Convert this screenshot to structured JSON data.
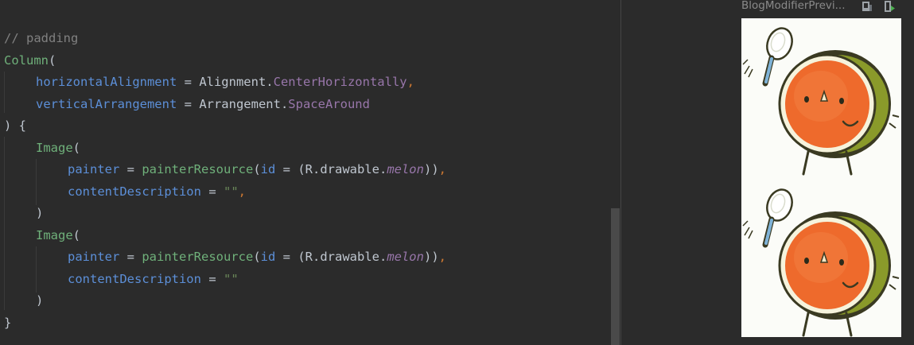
{
  "editor": {
    "lines": [
      {
        "segments": [
          {
            "t": "// padding",
            "c": "comment"
          }
        ]
      },
      {
        "segments": [
          {
            "t": "Column",
            "c": "call"
          },
          {
            "t": "(",
            "c": "plain"
          }
        ]
      },
      {
        "segments": [
          {
            "t": "horizontalAlignment",
            "c": "param"
          },
          {
            "t": " = ",
            "c": "plain"
          },
          {
            "t": "Alignment.",
            "c": "plain"
          },
          {
            "t": "CenterHorizontally",
            "c": "prop"
          },
          {
            "t": ",",
            "c": "punc"
          }
        ]
      },
      {
        "segments": [
          {
            "t": "verticalArrangement",
            "c": "param"
          },
          {
            "t": " = ",
            "c": "plain"
          },
          {
            "t": "Arrangement.",
            "c": "plain"
          },
          {
            "t": "SpaceAround",
            "c": "prop"
          }
        ]
      },
      {
        "segments": [
          {
            "t": ") {",
            "c": "plain"
          }
        ]
      },
      {
        "segments": [
          {
            "t": "Image",
            "c": "call"
          },
          {
            "t": "(",
            "c": "plain"
          }
        ]
      },
      {
        "segments": [
          {
            "t": "painter",
            "c": "param"
          },
          {
            "t": " = ",
            "c": "plain"
          },
          {
            "t": "painterResource",
            "c": "call"
          },
          {
            "t": "(",
            "c": "plain"
          },
          {
            "t": "id",
            "c": "param"
          },
          {
            "t": " = ",
            "c": "plain"
          },
          {
            "t": "(R.drawable.",
            "c": "plain"
          },
          {
            "t": "melon",
            "c": "ital"
          },
          {
            "t": "))",
            "c": "plain"
          },
          {
            "t": ",",
            "c": "punc"
          }
        ]
      },
      {
        "segments": [
          {
            "t": "contentDescription",
            "c": "param"
          },
          {
            "t": " = ",
            "c": "plain"
          },
          {
            "t": "\"\"",
            "c": "str"
          },
          {
            "t": ",",
            "c": "punc"
          }
        ]
      },
      {
        "segments": [
          {
            "t": ")",
            "c": "plain"
          }
        ]
      },
      {
        "segments": [
          {
            "t": "Image",
            "c": "call"
          },
          {
            "t": "(",
            "c": "plain"
          }
        ]
      },
      {
        "segments": [
          {
            "t": "painter",
            "c": "param"
          },
          {
            "t": " = ",
            "c": "plain"
          },
          {
            "t": "painterResource",
            "c": "call"
          },
          {
            "t": "(",
            "c": "plain"
          },
          {
            "t": "id",
            "c": "param"
          },
          {
            "t": " = ",
            "c": "plain"
          },
          {
            "t": "(R.drawable.",
            "c": "plain"
          },
          {
            "t": "melon",
            "c": "ital"
          },
          {
            "t": "))",
            "c": "plain"
          },
          {
            "t": ",",
            "c": "punc"
          }
        ]
      },
      {
        "segments": [
          {
            "t": "contentDescription",
            "c": "param"
          },
          {
            "t": " = ",
            "c": "plain"
          },
          {
            "t": "\"\"",
            "c": "str"
          }
        ]
      },
      {
        "segments": [
          {
            "t": ")",
            "c": "plain"
          }
        ]
      },
      {
        "segments": [
          {
            "t": "}",
            "c": "plain"
          }
        ]
      }
    ],
    "indent_levels": [
      0,
      0,
      1,
      1,
      0,
      1,
      2,
      2,
      1,
      1,
      2,
      2,
      1,
      0
    ]
  },
  "preview": {
    "title": "BlogModifierPrevi...",
    "icons": [
      "deploy-preview-icon",
      "interactive-preview-icon"
    ],
    "images": [
      {
        "name": "melon-image",
        "drawable": "melon"
      },
      {
        "name": "melon-image",
        "drawable": "melon"
      }
    ]
  },
  "colors": {
    "background": "#2b2b2b",
    "preview_canvas": "#fbfcf8",
    "melon_orange": "#ee6a2c",
    "melon_rind": "#8a9a2a"
  }
}
